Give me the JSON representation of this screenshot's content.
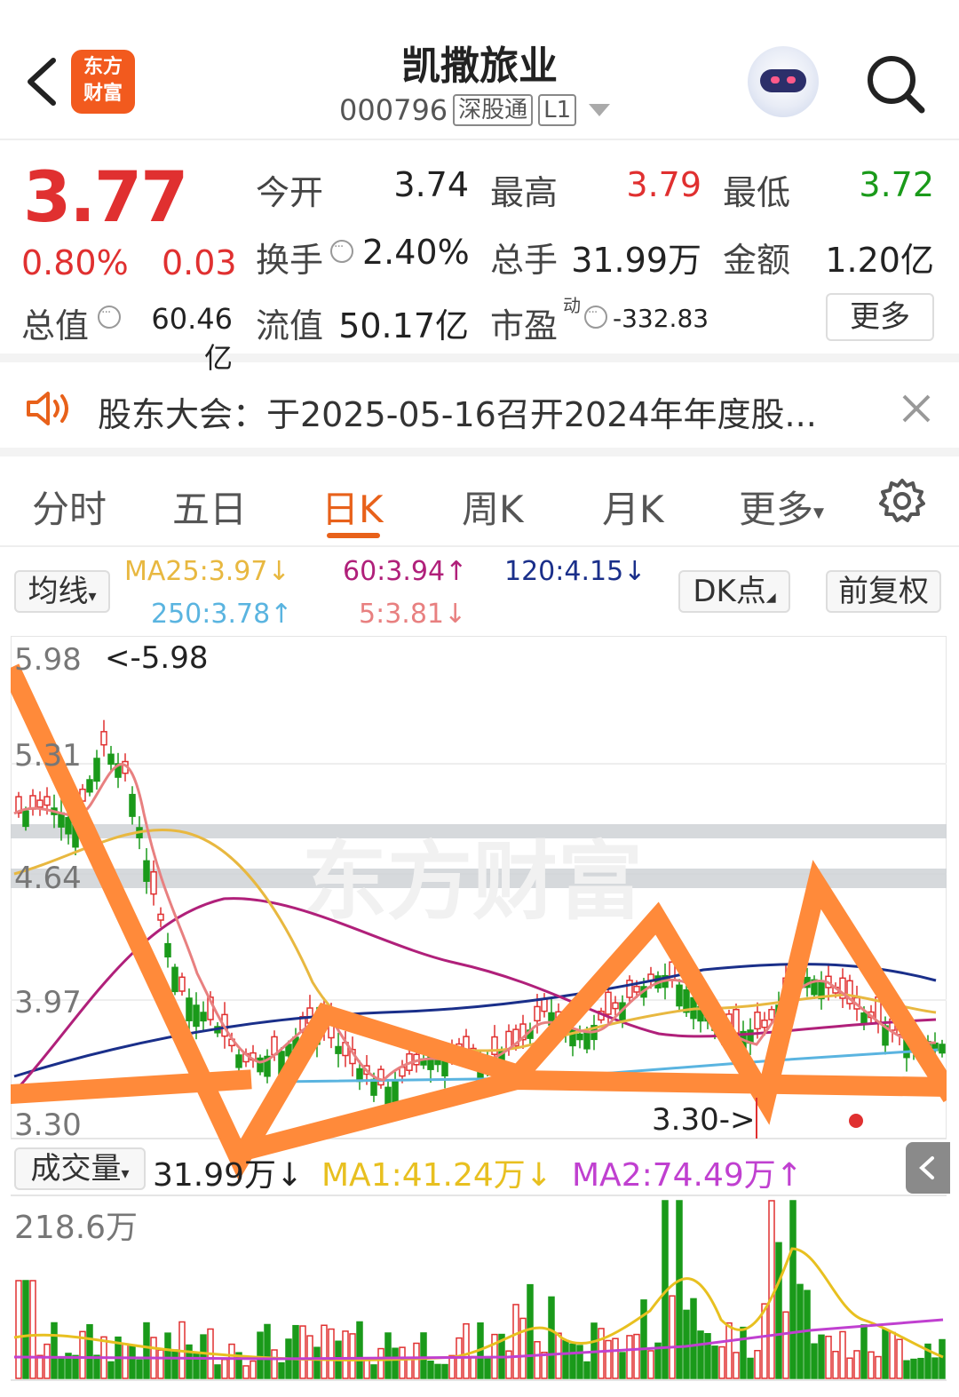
{
  "header": {
    "logo_line1": "东方",
    "logo_line2": "财富",
    "title": "凯撒旅业",
    "code": "000796",
    "tag1": "深股通",
    "tag2": "L1"
  },
  "quote": {
    "price": "3.77",
    "change_pct": "0.80%",
    "change": "0.03",
    "open_label": "今开",
    "open": "3.74",
    "high_label": "最高",
    "high": "3.79",
    "low_label": "最低",
    "low": "3.72",
    "turnover_label": "换手",
    "turnover": "2.40%",
    "volume_label": "总手",
    "volume": "31.99万",
    "amount_label": "金额",
    "amount": "1.20亿",
    "mcap_label": "总值",
    "mcap": "60.46亿",
    "float_label": "流值",
    "float_mcap": "50.17亿",
    "pe_label": "市盈",
    "pe_sup": "动",
    "pe": "-332.83",
    "more": "更多"
  },
  "notice": {
    "text": "股东大会：于2025-05-16召开2024年年度股..."
  },
  "tabs": [
    "分时",
    "五日",
    "日K",
    "周K",
    "月K",
    "更多"
  ],
  "active_tab": "日K",
  "ma_bar": {
    "selector": "均线",
    "ma25": "MA25:3.97↓",
    "ma60": "60:3.94↑",
    "ma120": "120:4.15↓",
    "ma250": "250:3.78↑",
    "ma5": "5:3.81↓",
    "dk": "DK点",
    "adjust": "前复权"
  },
  "chart_axis": {
    "y1": "5.98",
    "y2": "5.31",
    "y3": "4.64",
    "y4": "3.97",
    "y5": "3.30",
    "max_marker": "<-5.98",
    "min_marker": "3.30->",
    "watermark": "东方财富"
  },
  "volume_bar": {
    "selector": "成交量",
    "value": "31.99万↓",
    "ma1": "MA1:41.24万↓",
    "ma2": "MA2:74.49万↑",
    "max": "218.6万"
  },
  "colors": {
    "up": "#e03030",
    "down": "#1a9a1a",
    "accent": "#e8611a",
    "ma5": "#e88080",
    "ma25": "#e8b840",
    "ma60": "#b0207a",
    "ma120": "#1a2f8a",
    "ma250": "#5ab4e0",
    "overlay": "#ff8a3a"
  },
  "icons": [
    "back-chevron-icon",
    "search-icon",
    "speaker-icon",
    "close-icon",
    "gear-icon",
    "chevron-left-icon"
  ]
}
